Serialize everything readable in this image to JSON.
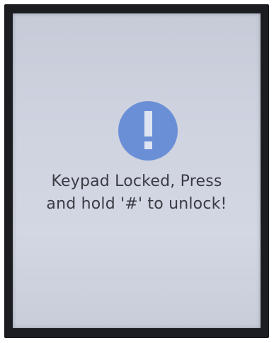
{
  "screen": {
    "alert_icon": "exclamation-icon",
    "message_line1": "Keypad Locked, Press",
    "message_line2": "and hold '#' to unlock!"
  },
  "colors": {
    "icon_fill": "#6b8fd6",
    "icon_mark": "#dde3f0",
    "text": "#3a3c44",
    "screen_bg": "#cfd3e0",
    "frame": "#1c1d21"
  }
}
